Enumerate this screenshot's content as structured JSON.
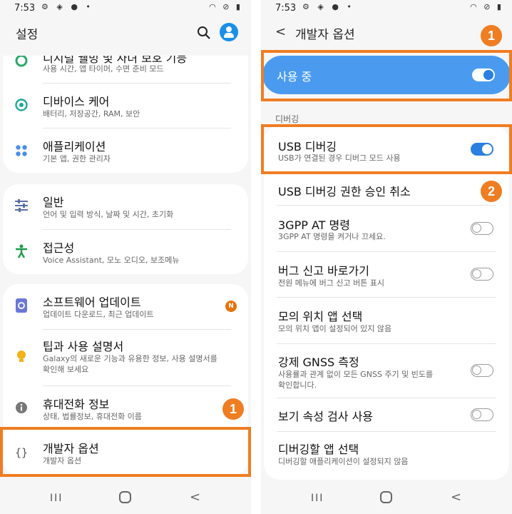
{
  "left": {
    "status": {
      "time": "7:53"
    },
    "header": {
      "title": "설정"
    },
    "card1": [
      {
        "title": "디지털 웰빙 및 자녀 보호 기능",
        "sub": "사용 시간, 앱 타이머, 수면 준비 모드"
      },
      {
        "title": "디바이스 케어",
        "sub": "배터리, 저장공간, RAM, 보안"
      },
      {
        "title": "애플리케이션",
        "sub": "기본 앱, 권한 관리자"
      }
    ],
    "card2": [
      {
        "title": "일반",
        "sub": "언어 및 입력 방식, 날짜 및 시간, 초기화"
      },
      {
        "title": "접근성",
        "sub": "Voice Assistant, 모노 오디오, 보조메뉴"
      }
    ],
    "card3": [
      {
        "title": "소프트웨어 업데이트",
        "sub": "업데이트 다운로드, 최근 업데이트",
        "badge": "N"
      },
      {
        "title": "팁과 사용 설명서",
        "sub1": "Galaxy의 새로운 기능과 유용한 정보, 사용 설명서를",
        "sub2": "확인해 보세요"
      },
      {
        "title": "휴대전화 정보",
        "sub": "상태, 법률정보, 휴대전화 이름"
      },
      {
        "title": "개발자 옵션",
        "sub": "개발자 옵션"
      }
    ],
    "callout": "1"
  },
  "right": {
    "status": {
      "time": "7:53"
    },
    "header": {
      "title": "개발자 옵션"
    },
    "master": {
      "label": "사용 중",
      "on": true
    },
    "section": "디버깅",
    "items": [
      {
        "title": "USB 디버깅",
        "sub": "USB가 연결된 경우 디버그 모드 사용",
        "toggle": "on"
      },
      {
        "title": "USB 디버깅 권한 승인 취소"
      },
      {
        "title": "3GPP AT 명령",
        "sub": "3GPP AT 명령을 켜거나 끄세요.",
        "toggle": "off"
      },
      {
        "title": "버그 신고 바로가기",
        "sub": "전원 메뉴에 버그 신고 버튼 표시",
        "toggle": "off"
      },
      {
        "title": "모의 위치 앱 선택",
        "sub": "모의 위치 앱이 설정되어 있지 않음"
      },
      {
        "title": "강제 GNSS 측정",
        "sub1": "사용률과 관계 없이 모든 GNSS 주기 및 빈도를",
        "sub2": "확인합니다.",
        "toggle": "off"
      },
      {
        "title": "보기 속성 검사 사용",
        "toggle": "off"
      },
      {
        "title": "디버깅할 앱 선택",
        "sub": "디버깅할 애플리케이션이 설정되지 않음"
      }
    ],
    "callout1": "1",
    "callout2": "2"
  },
  "colors": {
    "accent": "#ef7d22",
    "toggle_on": "#2b7fe0",
    "master_bg": "#4a9bf0"
  },
  "icons": [
    "search-icon",
    "avatar",
    "device-care-icon",
    "apps-icon",
    "general-icon",
    "accessibility-icon",
    "software-update-icon",
    "tips-icon",
    "info-icon",
    "developer-icon"
  ]
}
